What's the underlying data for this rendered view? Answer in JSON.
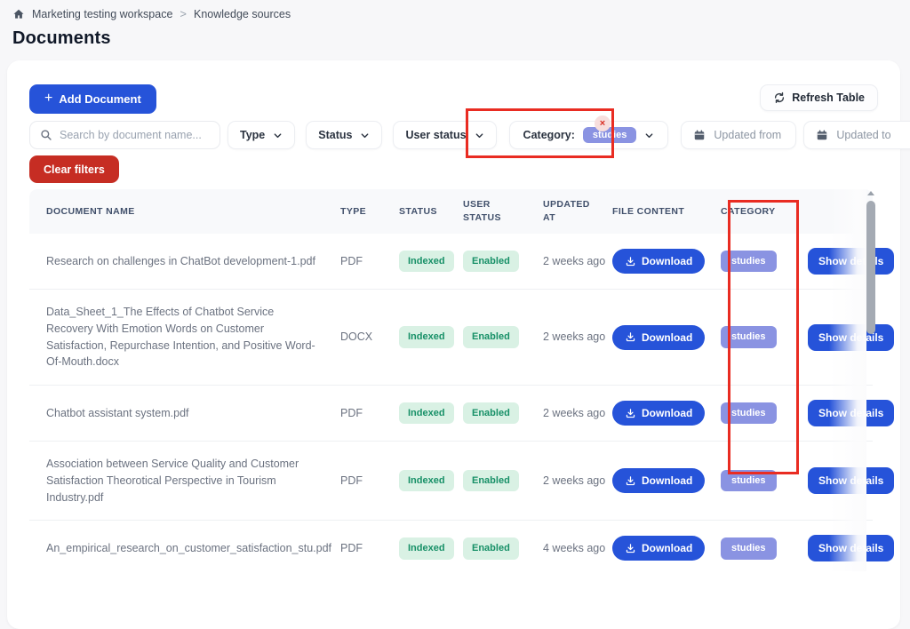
{
  "page": {
    "breadcrumb": {
      "workspace": "Marketing testing workspace",
      "separator": ">",
      "section": "Knowledge sources"
    },
    "title": "Documents"
  },
  "toolbar": {
    "add_document_label": "Add Document",
    "refresh_label": "Refresh Table",
    "clear_filters_label": "Clear filters"
  },
  "filters": {
    "search_placeholder": "Search by document name...",
    "type_label": "Type",
    "status_label": "Status",
    "user_status_label": "User status",
    "category_label": "Category:",
    "category_value": "studies",
    "updated_from_label": "Updated from",
    "updated_to_label": "Updated to",
    "remove_category_label": "×"
  },
  "table": {
    "headers": [
      "DOCUMENT NAME",
      "TYPE",
      "STATUS",
      "USER STATUS",
      "UPDATED AT",
      "FILE CONTENT",
      "CATEGORY",
      ""
    ],
    "download_label": "Download",
    "details_label": "Show details",
    "rows": [
      {
        "name": "Research on challenges in ChatBot development-1.pdf",
        "type": "PDF",
        "status": "Indexed",
        "user_status": "Enabled",
        "updated_at": "2 weeks ago",
        "category": "studies"
      },
      {
        "name": "Data_Sheet_1_The Effects of Chatbot Service Recovery With Emotion Words on Customer Satisfaction, Repurchase Intention, and Positive Word-Of-Mouth.docx",
        "type": "DOCX",
        "status": "Indexed",
        "user_status": "Enabled",
        "updated_at": "2 weeks ago",
        "category": "studies"
      },
      {
        "name": "Chatbot assistant system.pdf",
        "type": "PDF",
        "status": "Indexed",
        "user_status": "Enabled",
        "updated_at": "2 weeks ago",
        "category": "studies"
      },
      {
        "name": "Association between Service Quality and Customer Satisfaction Theorotical Perspective in Tourism Industry.pdf",
        "type": "PDF",
        "status": "Indexed",
        "user_status": "Enabled",
        "updated_at": "2 weeks ago",
        "category": "studies"
      },
      {
        "name": "An_empirical_research_on_customer_satisfaction_stu.pdf",
        "type": "PDF",
        "status": "Indexed",
        "user_status": "Enabled",
        "updated_at": "4 weeks ago",
        "category": "studies"
      }
    ]
  },
  "colors": {
    "primary_blue": "#2653d9",
    "danger_red": "#c62d23",
    "annotation_red": "#e92c22",
    "badge_green_bg": "#d9f1e4",
    "badge_green_text": "#179067",
    "badge_indigo_bg": "#8a93e2",
    "page_bg": "#f7f7f9"
  }
}
